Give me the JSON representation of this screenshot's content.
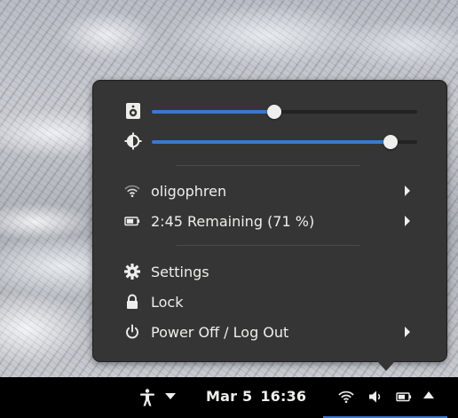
{
  "menu": {
    "volume_level": 0.46,
    "brightness_level": 0.9,
    "items": [
      {
        "id": "wifi",
        "label": "oligophren",
        "icon": "wifi-icon",
        "has_submenu": true
      },
      {
        "id": "battery",
        "label": "2:45 Remaining (71 %)",
        "icon": "battery-icon",
        "has_submenu": true
      },
      {
        "id": "settings",
        "label": "Settings",
        "icon": "gear-icon",
        "has_submenu": false
      },
      {
        "id": "lock",
        "label": "Lock",
        "icon": "lock-icon",
        "has_submenu": false
      },
      {
        "id": "power",
        "label": "Power Off / Log Out",
        "icon": "power-icon",
        "has_submenu": true
      }
    ]
  },
  "panel": {
    "date": "Mar 5",
    "time": "16:36",
    "icons": [
      "accessibility-icon",
      "caret-down-icon",
      "wifi-icon",
      "volume-icon",
      "battery-icon",
      "caret-up-icon"
    ]
  },
  "colors": {
    "menu_bg": "#353535",
    "accent": "#3d78c9",
    "text": "#eeeeec",
    "panel_bg": "#000000"
  }
}
